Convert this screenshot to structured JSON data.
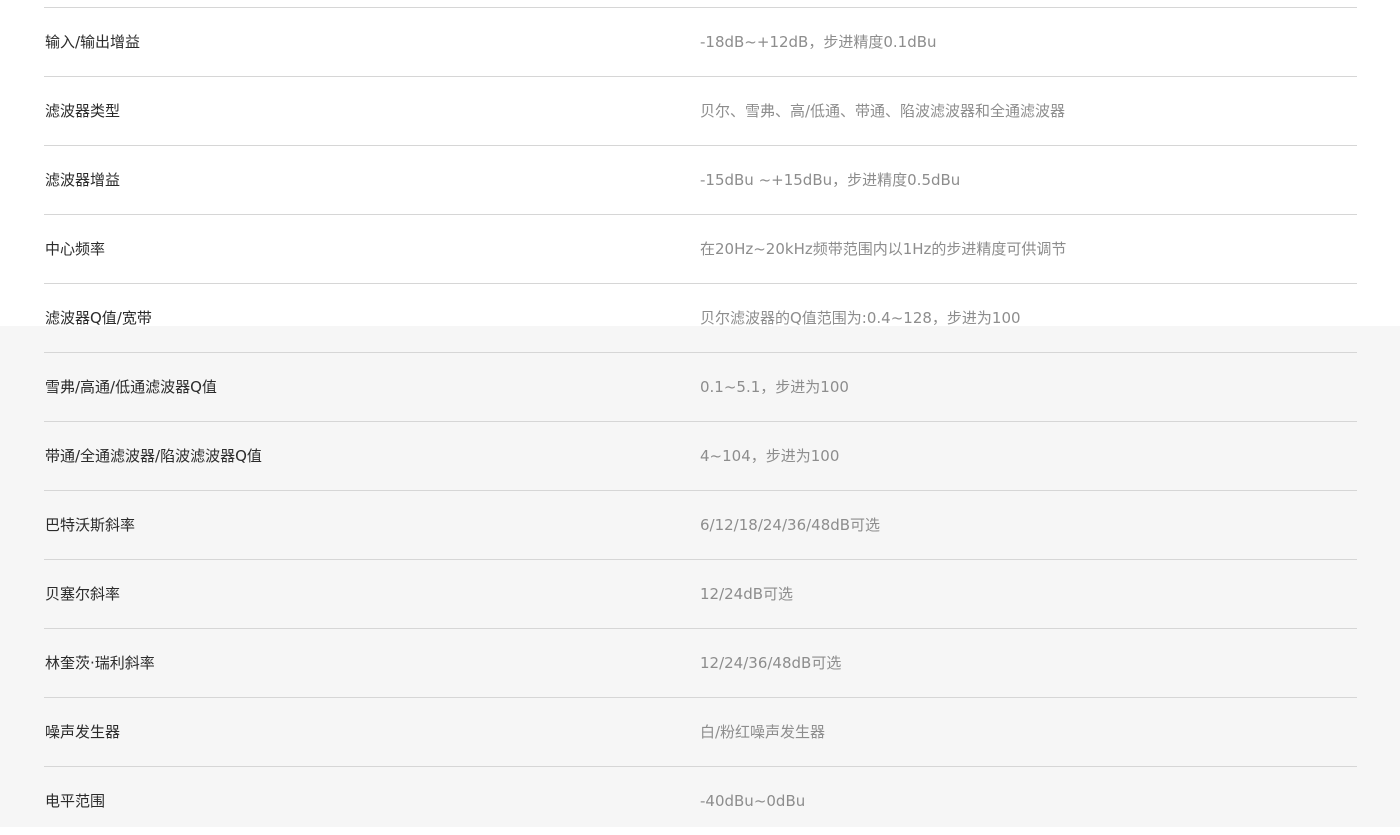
{
  "specs": [
    {
      "label": "输入/输出增益",
      "value": "-18dB~+12dB，步进精度0.1dBu"
    },
    {
      "label": "滤波器类型",
      "value": "贝尔、雪弗、高/低通、带通、陷波滤波器和全通滤波器"
    },
    {
      "label": "滤波器增益",
      "value": "-15dBu ~+15dBu，步进精度0.5dBu"
    },
    {
      "label": "中心频率",
      "value": "在20Hz~20kHz频带范围内以1Hz的步进精度可供调节"
    },
    {
      "label": "滤波器Q值/宽带",
      "value": "贝尔滤波器的Q值范围为:0.4~128，步进为100"
    },
    {
      "label": "雪弗/高通/低通滤波器Q值",
      "value": "0.1~5.1，步进为100"
    },
    {
      "label": "带通/全通滤波器/陷波滤波器Q值",
      "value": "4~104，步进为100"
    },
    {
      "label": "巴特沃斯斜率",
      "value": "6/12/18/24/36/48dB可选"
    },
    {
      "label": "贝塞尔斜率",
      "value": "12/24dB可选"
    },
    {
      "label": "林奎茨·瑞利斜率",
      "value": "12/24/36/48dB可选"
    },
    {
      "label": "噪声发生器",
      "value": "白/粉红噪声发生器"
    },
    {
      "label": "电平范围",
      "value": "-40dBu~0dBu"
    }
  ]
}
